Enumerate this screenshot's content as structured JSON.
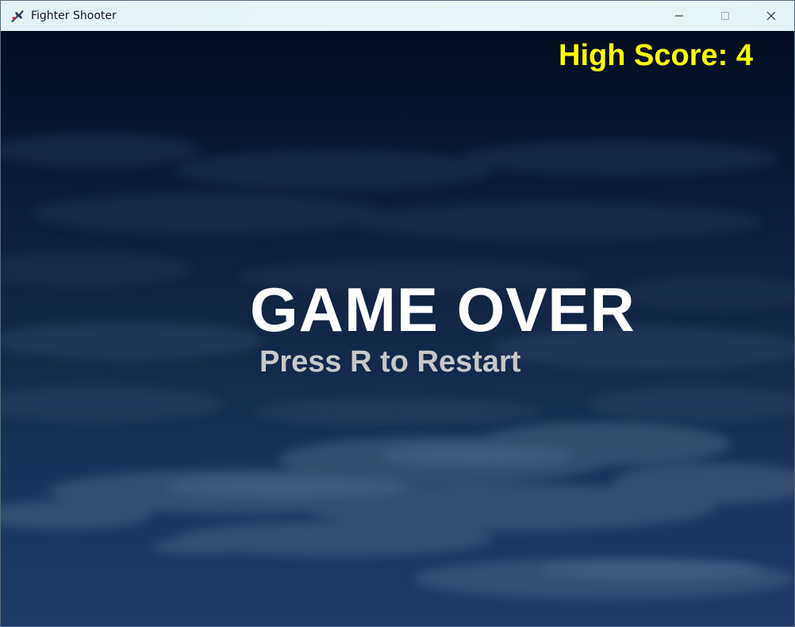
{
  "window": {
    "title": "Fighter Shooter",
    "icon": "fighter-jet-icon",
    "controls": [
      "minimize-icon",
      "maximize-icon",
      "close-icon"
    ]
  },
  "hud": {
    "high_score_label": "High Score: 4"
  },
  "screen": {
    "headline": "GAME OVER",
    "prompt": "Press R to Restart"
  },
  "colors": {
    "high_score": "#ffff00",
    "headline": "#ffffff",
    "prompt": "#c8c8c8",
    "sky_top": "#050c1f",
    "sky_bottom": "#1d3c6b",
    "clouds": "#3a5479"
  }
}
